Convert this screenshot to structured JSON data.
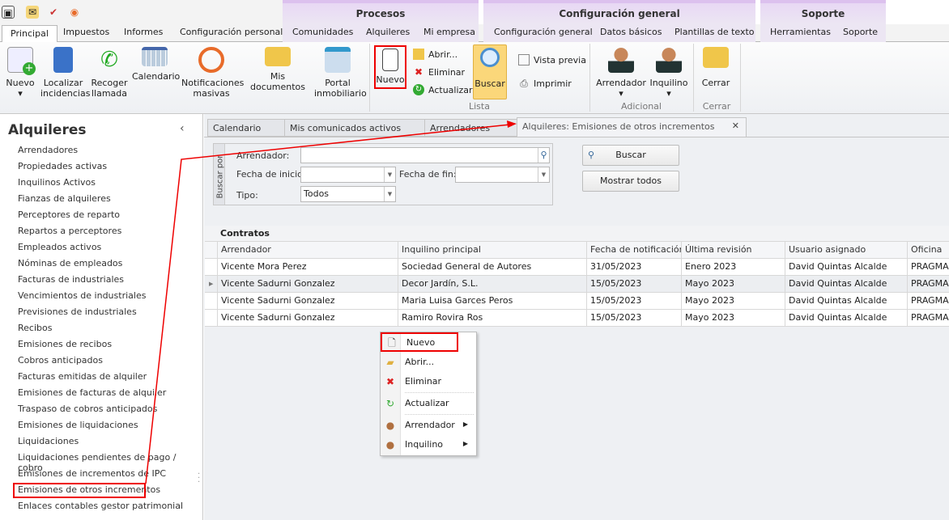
{
  "quick_access": [
    "app-icon",
    "mail-icon",
    "clipboard-icon",
    "broadcast-icon"
  ],
  "context_groups": [
    {
      "label": "Procesos"
    },
    {
      "label": "Configuración general"
    },
    {
      "label": "Soporte"
    }
  ],
  "ribbon_tabs": [
    "Principal",
    "Impuestos",
    "Informes",
    "Configuración personal",
    "Comunidades",
    "Alquileres",
    "Mi empresa",
    "Configuración general",
    "Datos básicos",
    "Plantillas de texto",
    "Herramientas",
    "Soporte"
  ],
  "ribbon": {
    "main_buttons": [
      "Nuevo",
      "Localizar incidencias",
      "Recoger llamada",
      "Calendario",
      "Notificaciones masivas",
      "Mis documentos",
      "Portal inmobiliario"
    ],
    "lista": {
      "nuevo": "Nuevo",
      "abrir": "Abrir...",
      "eliminar": "Eliminar",
      "actualizar": "Actualizar",
      "buscar": "Buscar",
      "vista_previa": "Vista previa",
      "imprimir": "Imprimir",
      "group": "Lista"
    },
    "adicional": {
      "arrendador": "Arrendador",
      "inquilino": "Inquilino",
      "group": "Adicional"
    },
    "cerrar": {
      "label": "Cerrar",
      "group": "Cerrar"
    }
  },
  "sidebar": {
    "title": "Alquileres",
    "items": [
      "Arrendadores",
      "Propiedades activas",
      "Inquilinos Activos",
      "Fianzas de alquileres",
      "Perceptores de reparto",
      "Repartos a perceptores",
      "Empleados activos",
      "Nóminas de empleados",
      "Facturas de industriales",
      "Vencimientos de industriales",
      "Previsiones de industriales",
      "Recibos",
      "Emisiones de recibos",
      "Cobros anticipados",
      "Facturas emitidas de alquiler",
      "Emisiones de facturas de alquiler",
      "Traspaso de cobros anticipados",
      "Emisiones de liquidaciones",
      "Liquidaciones",
      "Liquidaciones pendientes de pago / cobro",
      "Emisiones de incrementos de IPC",
      "Emisiones de otros incrementos",
      "Enlaces contables gestor patrimonial"
    ],
    "selected": "Emisiones de otros incrementos"
  },
  "doc_tabs": [
    "Calendario",
    "Mis comunicados activos",
    "Arrendadores",
    "Alquileres: Emisiones  de otros incrementos"
  ],
  "filter": {
    "group_label": "Buscar por",
    "arrendador_label": "Arrendador:",
    "arrendador_value": "",
    "fecha_inicio_label": "Fecha de inicio:",
    "fecha_inicio_value": "",
    "fecha_fin_label": "Fecha de fin:",
    "fecha_fin_value": "",
    "tipo_label": "Tipo:",
    "tipo_value": "Todos",
    "buscar": "Buscar",
    "mostrar_todos": "Mostrar todos"
  },
  "grid": {
    "title": "Contratos",
    "columns": [
      "Arrendador",
      "Inquilino principal",
      "Fecha de notificación",
      "Última revisión",
      "Usuario asignado",
      "Oficina"
    ],
    "rows": [
      [
        "Vicente Mora Perez",
        "Sociedad General de Autores",
        "31/05/2023",
        "Enero 2023",
        "David Quintas Alcalde",
        "PRAGMA"
      ],
      [
        "Vicente Sadurni Gonzalez",
        "Decor Jardín, S.L.",
        "15/05/2023",
        "Mayo 2023",
        "David Quintas Alcalde",
        "PRAGMA"
      ],
      [
        "Vicente Sadurni Gonzalez",
        "Maria Luisa Garces Peros",
        "15/05/2023",
        "Mayo 2023",
        "David Quintas Alcalde",
        "PRAGMA"
      ],
      [
        "Vicente Sadurni Gonzalez",
        "Ramiro Rovira Ros",
        "15/05/2023",
        "Mayo 2023",
        "David Quintas Alcalde",
        "PRAGMA"
      ]
    ]
  },
  "context_menu": [
    "Nuevo",
    "Abrir...",
    "Eliminar",
    "Actualizar",
    "Arrendador",
    "Inquilino"
  ],
  "colors": {
    "accent_red": "#e00000",
    "context_purple": "#e8d8f4",
    "buscar_active": "#fbd77a"
  }
}
